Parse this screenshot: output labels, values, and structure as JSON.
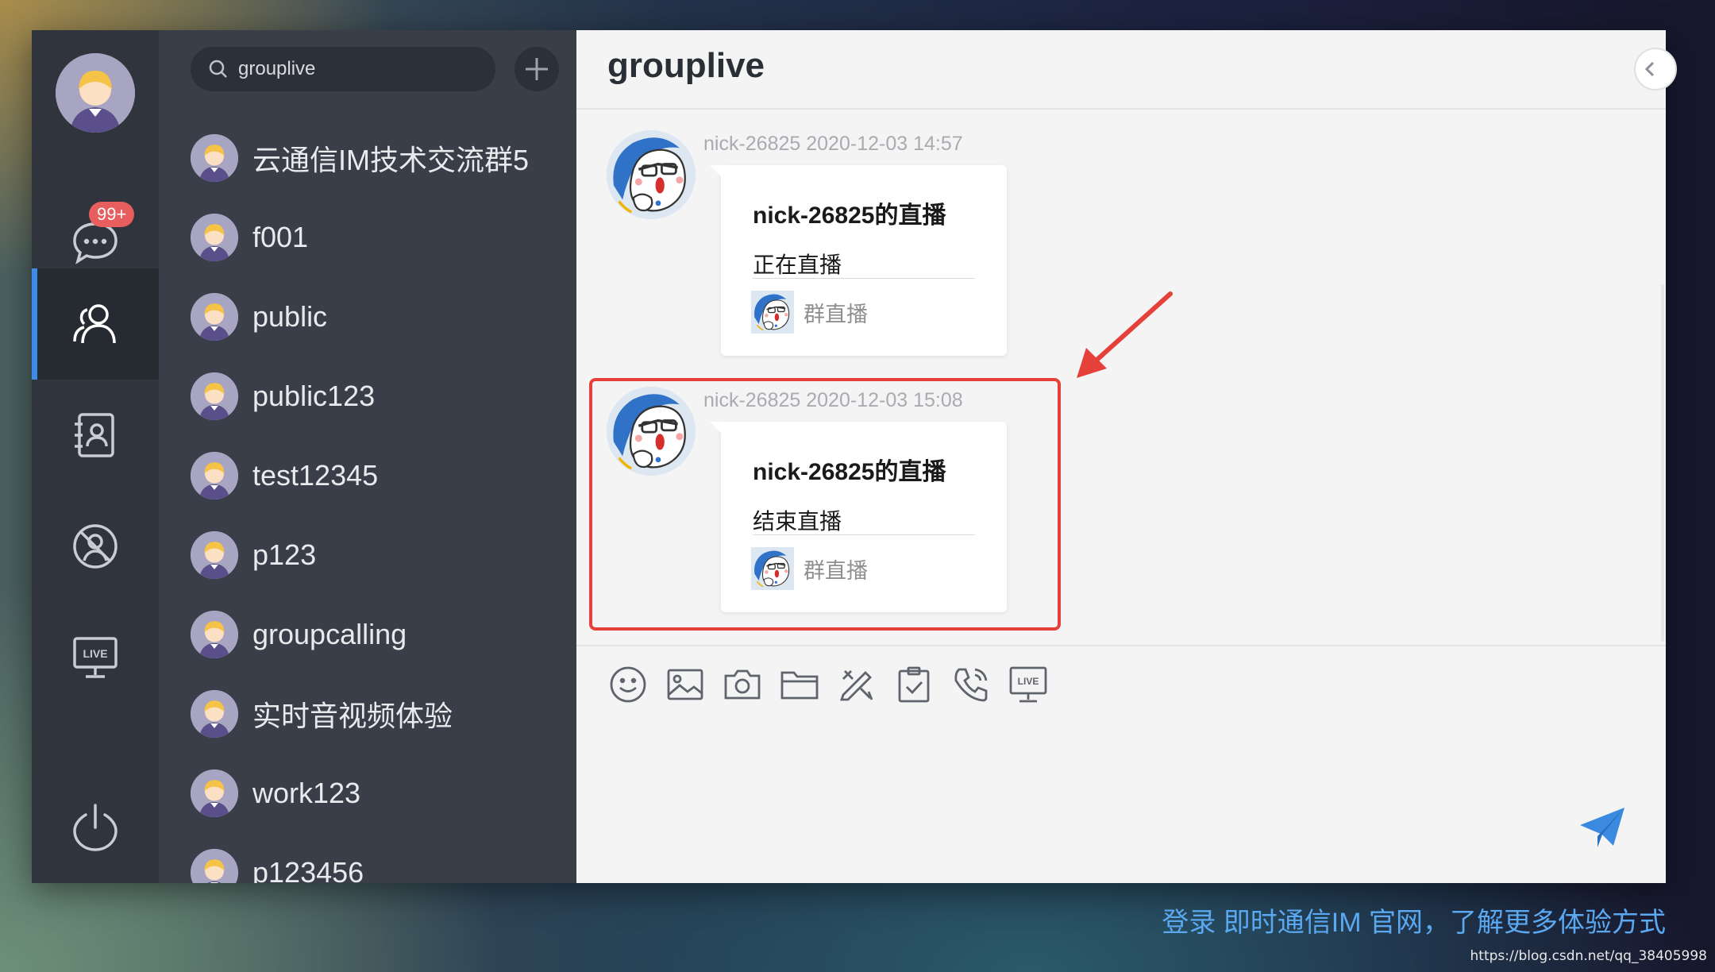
{
  "nav": {
    "unread_badge": "99+",
    "items": [
      "chat",
      "groups",
      "contacts",
      "blacklist",
      "live"
    ]
  },
  "search": {
    "value": "grouplive"
  },
  "conversations": [
    "云通信IM技术交流群5",
    "f001",
    "public",
    "public123",
    "test12345",
    "p123",
    "groupcalling",
    "实时音视频体验",
    "work123",
    "p123456"
  ],
  "chat": {
    "title": "grouplive",
    "messages": [
      {
        "meta": "nick-26825 2020-12-03 14:57",
        "title": "nick-26825的直播",
        "status": "正在直播",
        "footer": "群直播"
      },
      {
        "meta": "nick-26825 2020-12-03 15:08",
        "title": "nick-26825的直播",
        "status": "结束直播",
        "footer": "群直播"
      }
    ]
  },
  "toolbar": [
    "emoji-icon",
    "image-icon",
    "camera-icon",
    "folder-icon",
    "tools-icon",
    "clipboard-check-icon",
    "phone-icon",
    "live-icon"
  ],
  "colors": {
    "accent": "#3c8ce6",
    "badge": "#e85d5d",
    "highlight": "#e5413a",
    "send": "#3a8be0"
  },
  "footer": {
    "promo": "登录 即时通信IM 官网，了解更多体验方式",
    "watermark": "https://blog.csdn.net/qq_38405998"
  }
}
